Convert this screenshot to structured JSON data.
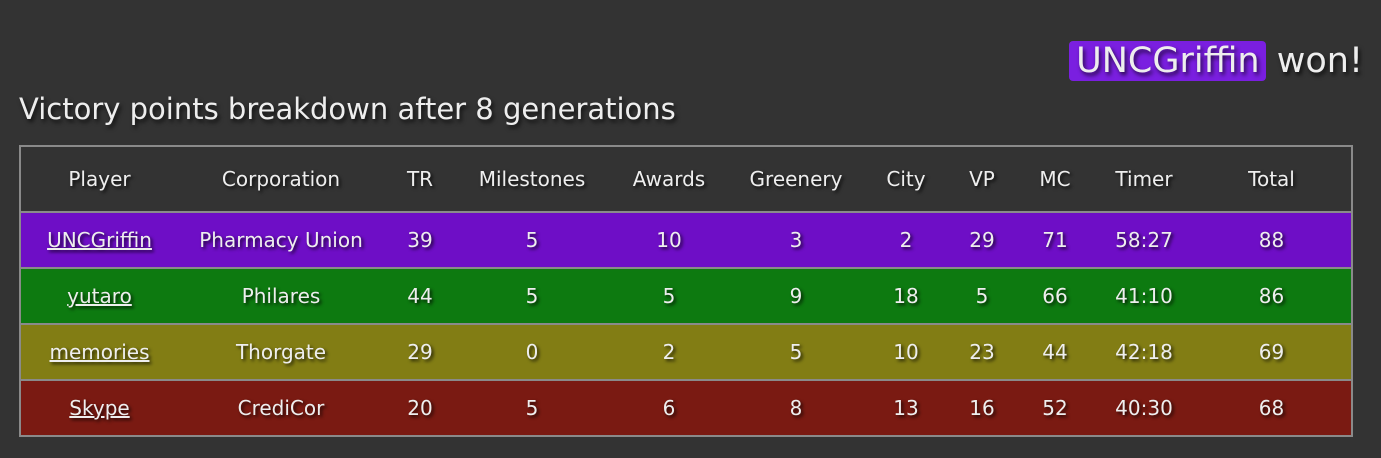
{
  "winner": {
    "name": "UNCGriffin",
    "suffix": "won!",
    "highlight_color": "#7a1fe0"
  },
  "heading": "Victory points breakdown after 8 generations",
  "table": {
    "headers": [
      "Player",
      "Corporation",
      "TR",
      "Milestones",
      "Awards",
      "Greenery",
      "City",
      "VP",
      "MC",
      "Timer",
      "Total"
    ],
    "rows": [
      {
        "player": "UNCGriffin",
        "corporation": "Pharmacy Union",
        "tr": "39",
        "milestones": "5",
        "awards": "10",
        "greenery": "3",
        "city": "2",
        "vp": "29",
        "mc": "71",
        "timer": "58:27",
        "total": "88",
        "color": "#6e0ec6"
      },
      {
        "player": "yutaro",
        "corporation": "Philares",
        "tr": "44",
        "milestones": "5",
        "awards": "5",
        "greenery": "9",
        "city": "18",
        "vp": "5",
        "mc": "66",
        "timer": "41:10",
        "total": "86",
        "color": "#0d7a10"
      },
      {
        "player": "memories",
        "corporation": "Thorgate",
        "tr": "29",
        "milestones": "0",
        "awards": "2",
        "greenery": "5",
        "city": "10",
        "vp": "23",
        "mc": "44",
        "timer": "42:18",
        "total": "69",
        "color": "#827d14"
      },
      {
        "player": "Skype",
        "corporation": "CrediCor",
        "tr": "20",
        "milestones": "5",
        "awards": "6",
        "greenery": "8",
        "city": "13",
        "vp": "16",
        "mc": "52",
        "timer": "40:30",
        "total": "68",
        "color": "#7a1a12"
      }
    ]
  }
}
